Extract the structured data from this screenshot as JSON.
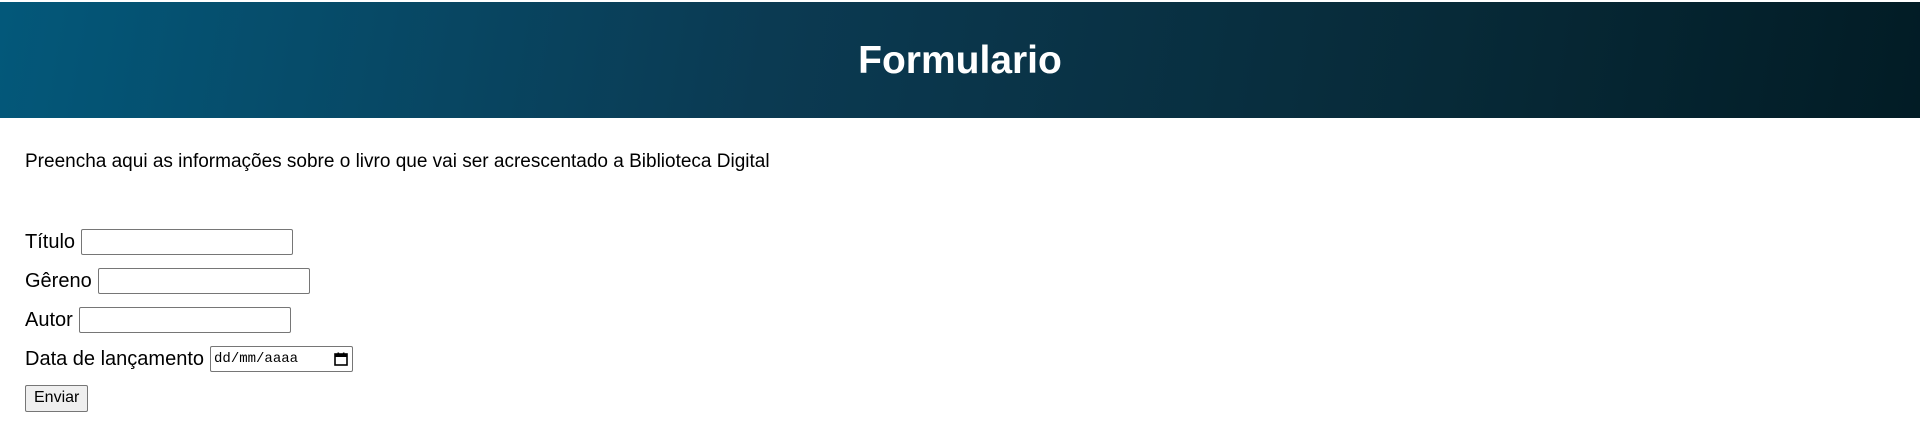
{
  "header": {
    "title": "Formulario"
  },
  "intro": {
    "text": "Preencha aqui as informações sobre o livro que vai ser acrescentado a Biblioteca Digital"
  },
  "form": {
    "fields": {
      "titulo": {
        "label": "Título",
        "value": ""
      },
      "genero": {
        "label": "Gêreno",
        "value": ""
      },
      "autor": {
        "label": "Autor",
        "value": ""
      },
      "data_lancamento": {
        "label": "Data de lançamento",
        "placeholder": "dd/mm/aaaa"
      }
    },
    "submit_label": "Enviar"
  },
  "colors": {
    "header_gradient_start": "#03587a",
    "header_gradient_end": "#021c25",
    "header_text": "#ffffff"
  },
  "icons": {
    "date_picker": "calendar-icon"
  }
}
